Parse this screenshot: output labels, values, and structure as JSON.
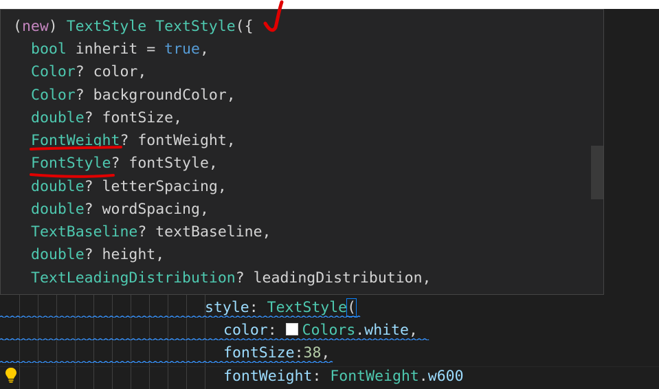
{
  "hover": {
    "line0": {
      "p1": "(",
      "kw": "new",
      "p2": ") ",
      "cls1": "TextStyle",
      "sp": " ",
      "cls2": "TextStyle",
      "p3": "({"
    },
    "params": [
      {
        "type": "bool",
        "rest": " inherit = ",
        "val": "true",
        "end": ","
      },
      {
        "type": "Color",
        "rest": "? color,"
      },
      {
        "type": "Color",
        "rest": "? backgroundColor,"
      },
      {
        "type": "double",
        "rest": "? fontSize,"
      },
      {
        "type": "FontWeight",
        "rest": "? fontWeight,"
      },
      {
        "type": "FontStyle",
        "rest": "? fontStyle,"
      },
      {
        "type": "double",
        "rest": "? letterSpacing,"
      },
      {
        "type": "double",
        "rest": "? wordSpacing,"
      },
      {
        "type": "TextBaseline",
        "rest": "? textBaseline,"
      },
      {
        "type": "double",
        "rest": "? height,"
      },
      {
        "type": "TextLeadingDistribution",
        "rest": "? leadingDistribution,"
      }
    ]
  },
  "editor": {
    "l1": {
      "prop": "style",
      "colon": ": ",
      "cls": "TextStyle",
      "paren": "("
    },
    "l2": {
      "prop": "color",
      "colon": ": ",
      "cls": "Colors",
      "dot": ".",
      "prop2": "white",
      "end": ","
    },
    "l3": {
      "prop": "fontSize",
      "colon": ":",
      "num": "38",
      "end": ","
    },
    "l4": {
      "prop": "fontWeight",
      "colon": ": ",
      "cls": "FontWeight",
      "dot": ".",
      "prop2": "w600"
    }
  },
  "colors": {
    "accent": "#4ec9b0",
    "annotation": "#e00000",
    "squiggle": "#3794ff"
  }
}
